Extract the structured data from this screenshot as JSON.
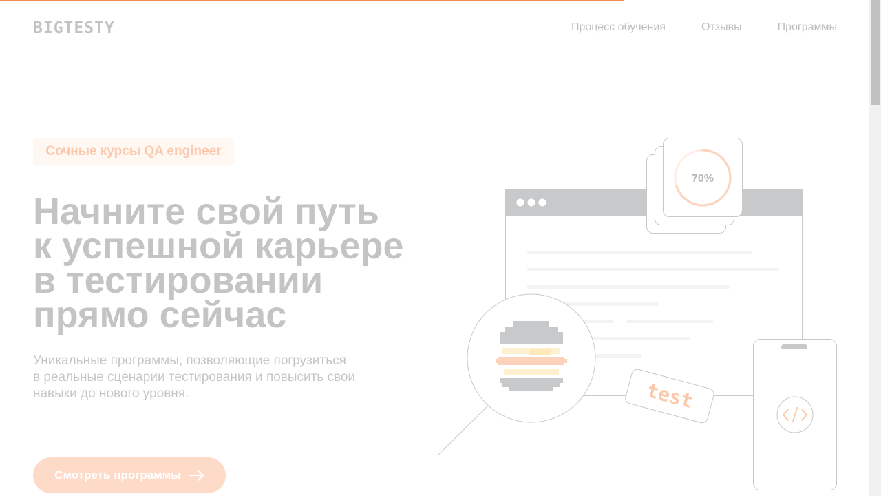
{
  "page": {
    "scroll_progress_percent": 70.8
  },
  "header": {
    "logo": "BIGTESTY",
    "nav": [
      "Процесс обучения",
      "Отзывы",
      "Программы"
    ]
  },
  "hero": {
    "tagline": "Сочные курсы QA engineer",
    "headline_lines": [
      "Начните свой путь",
      "к успешной карьере",
      "в тестировании",
      "прямо сейчас"
    ],
    "description_lines": [
      "Уникальные программы, позволяющие погрузиться",
      "в реальные сценарии тестирования и повысить свои",
      "навыки до нового уровня."
    ],
    "cta_label": "Смотреть программы",
    "cta_icon": "arrow-right-icon"
  },
  "illustration": {
    "progress_label": "70%",
    "progress_value": 0.7,
    "tag_label": "test",
    "device_icon": "code-icon"
  },
  "colors": {
    "accent": "#f58b55",
    "accent_light": "#fddbc8",
    "muted_text": "#c4c4c4"
  }
}
